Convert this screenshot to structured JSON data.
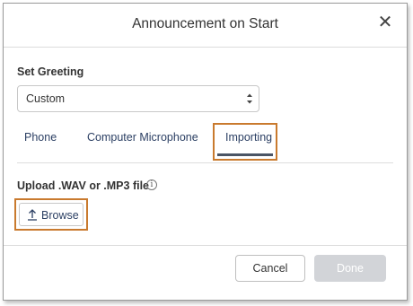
{
  "dialog": {
    "title": "Announcement on Start",
    "close_icon": "close-icon"
  },
  "greeting": {
    "label": "Set Greeting",
    "selected": "Custom"
  },
  "tabs": [
    {
      "label": "Phone",
      "active": false
    },
    {
      "label": "Computer Microphone",
      "active": false
    },
    {
      "label": "Importing",
      "active": true
    }
  ],
  "upload": {
    "label": "Upload .WAV or .MP3 file",
    "info_icon": "info-icon",
    "browse_label": "Browse",
    "browse_icon": "upload-icon"
  },
  "footer": {
    "cancel_label": "Cancel",
    "done_label": "Done",
    "done_enabled": false
  },
  "colors": {
    "highlight": "#c97a2e",
    "link_text": "#2b3f63",
    "disabled_button": "#d2d4d8"
  }
}
